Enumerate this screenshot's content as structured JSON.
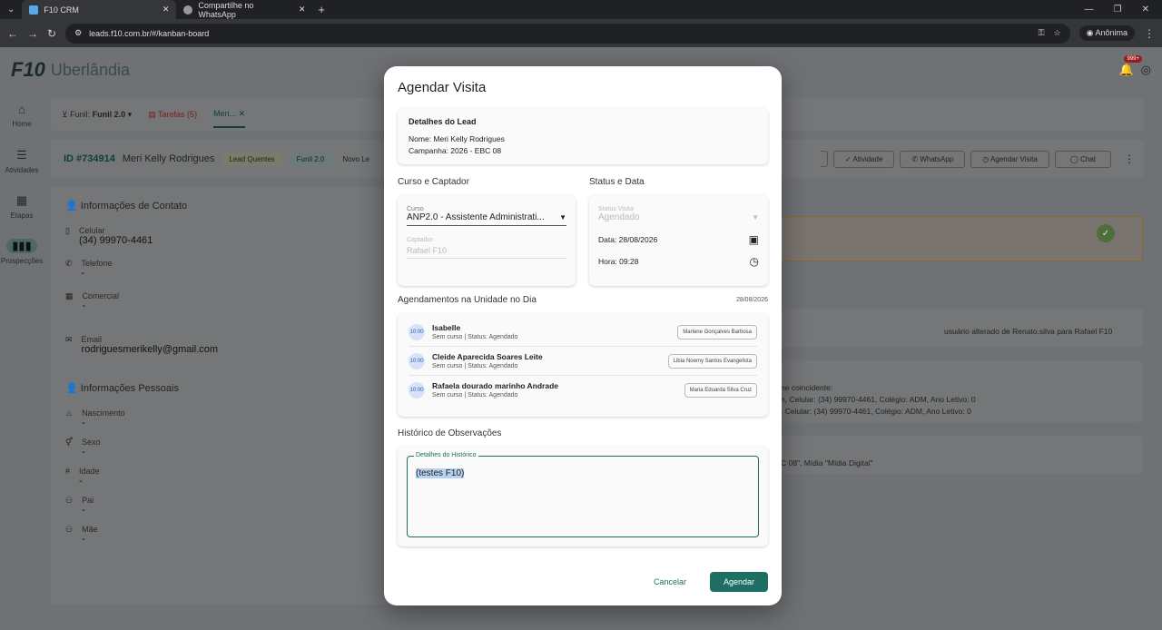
{
  "browser": {
    "tabs": [
      {
        "title": "F10 CRM",
        "active": true
      },
      {
        "title": "Compartilhe no WhatsApp",
        "active": false
      }
    ],
    "url": "leads.f10.com.br/#/kanban-board",
    "profile_label": "Anônima"
  },
  "app": {
    "logo": "F10",
    "unit_name": "Uberlândia",
    "notification_badge": "999+",
    "nav": [
      {
        "label": "Home",
        "icon": "home-icon"
      },
      {
        "label": "Atividades",
        "icon": "checklist-icon"
      },
      {
        "label": "Etapas",
        "icon": "board-icon"
      },
      {
        "label": "Prospecções",
        "icon": "columns-icon"
      }
    ],
    "toolbar": {
      "funnel_label": "Funil:",
      "funnel_value": "Funil 2.0",
      "tasks_tab": "Tarefas (5)",
      "lead_tab": "Meri..."
    },
    "lead": {
      "id": "ID #734914",
      "name": "Meri Kelly Rodrigues",
      "tags": [
        "Lead Quentes",
        "Funil 2.0",
        "Novo Le"
      ],
      "actions": [
        "Atividade",
        "WhatsApp",
        "Agendar Visita",
        "Chat"
      ]
    },
    "contact": {
      "title": "Informações de Contato",
      "fields": [
        {
          "label": "Celular",
          "value": "(34) 99970-4461"
        },
        {
          "label": "Telefone",
          "value": "-"
        },
        {
          "label": "Comercial",
          "value": "-"
        },
        {
          "label": "Email",
          "value": "rodriguesmerikelly@gmail.com"
        }
      ]
    },
    "personal": {
      "title": "Informações Pessoais",
      "fields": [
        {
          "label": "Nascimento",
          "value": "-"
        },
        {
          "label": "Sexo",
          "value": "-"
        },
        {
          "label": "Idade",
          "value": "-"
        },
        {
          "label": "Pai",
          "value": "-"
        },
        {
          "label": "Mãe",
          "value": "-"
        }
      ]
    },
    "history_snippets": [
      "usuário alterado de Renato.silva para Rafael F10",
      "ne coincidente:",
      "n, Celular: (34) 99970-4461, Colégio: ADM, Ano Letivo: 0",
      ", Celular: (34) 99970-4461, Colégio: ADM, Ano Letivo: 0",
      "C 08\", Mídia \"Mídia Digital\""
    ]
  },
  "modal": {
    "title": "Agendar Visita",
    "lead_details": {
      "title": "Detalhes do Lead",
      "name_line": "Nome: Meri Kelly Rodrigues",
      "campaign_line": "Campanha: 2026 - EBC 08"
    },
    "course_section": {
      "title": "Curso e Captador",
      "course_label": "Curso",
      "course_value": "ANP2.0 - Assistente Administrati...",
      "captador_label": "Captador",
      "captador_value": "Rafael F10"
    },
    "status_section": {
      "title": "Status e Data",
      "status_label": "Status Visita",
      "status_value": "Agendado",
      "date_line": "Data: 28/08/2026",
      "time_line": "Hora: 09:28"
    },
    "appointments": {
      "title": "Agendamentos na Unidade no Dia",
      "date": "28/08/2026",
      "items": [
        {
          "time": "10:00",
          "name": "Isabelle",
          "info": "Sem curso | Status: Agendado",
          "consultant": "Marlene Gonçalves Barbosa"
        },
        {
          "time": "10:00",
          "name": "Cleide Aparecida Soares Leite",
          "info": "Sem curso | Status: Agendado",
          "consultant": "Libia Noemy Santos Evangelista"
        },
        {
          "time": "10:00",
          "name": "Rafaela dourado marinho Andrade",
          "info": "Sem curso | Status: Agendado",
          "consultant": "Maria Eduarda Silva Cruz"
        }
      ]
    },
    "history": {
      "title": "Histórico de Observações",
      "field_label": "Detalhes do Histórico",
      "value": "(testes F10)"
    },
    "buttons": {
      "cancel": "Cancelar",
      "submit": "Agendar"
    }
  },
  "colors": {
    "primary": "#1e6e64",
    "tasks_red": "#c0392b"
  }
}
